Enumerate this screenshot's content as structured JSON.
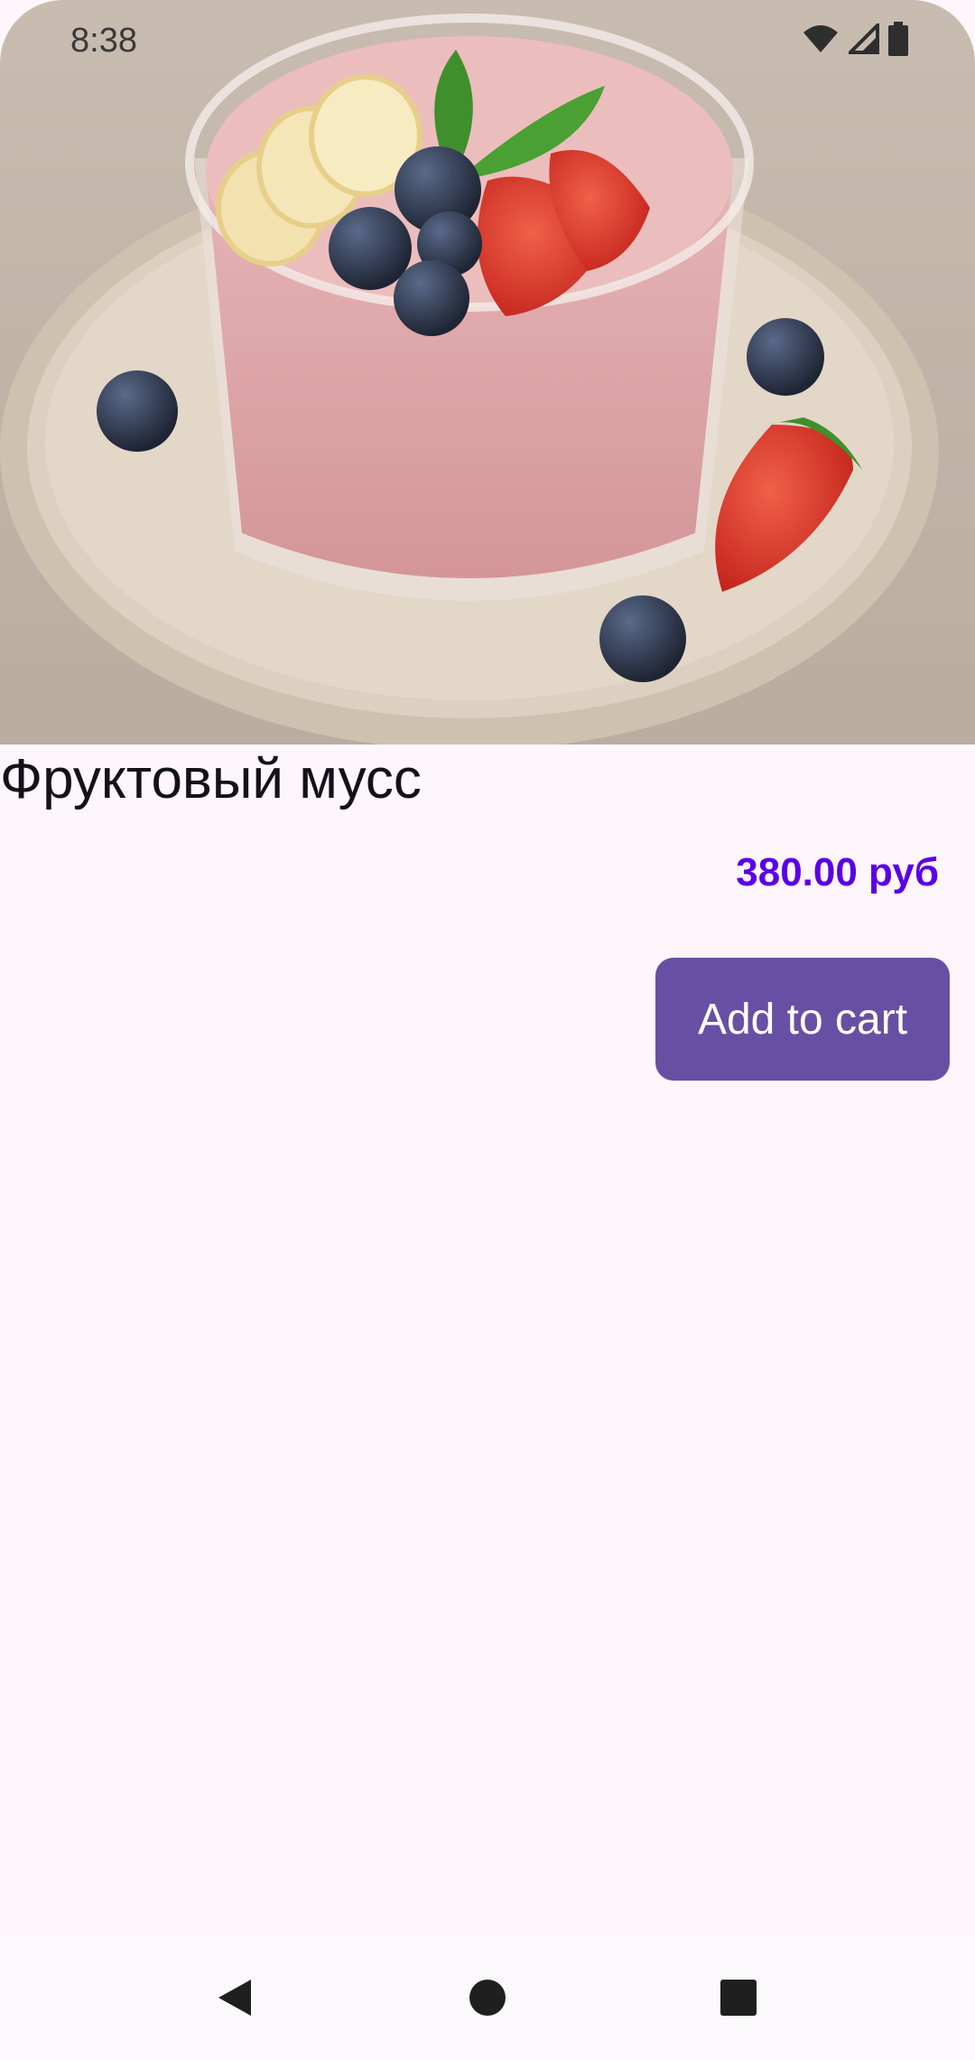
{
  "status_bar": {
    "time": "8:38",
    "icons": [
      "wifi-icon",
      "signal-icon",
      "battery-icon"
    ]
  },
  "product": {
    "image_icon": "fruit-mousse-photo",
    "title": "Фруктовый мусс",
    "price": "380.00 руб",
    "add_to_cart_label": "Add to cart"
  },
  "nav_bar": {
    "icons": [
      "back-icon",
      "home-icon",
      "recents-icon"
    ]
  },
  "colors": {
    "background": "#fdf6fd",
    "price": "#5b00e6",
    "button": "#6750a4",
    "button_text": "#ffffff"
  }
}
